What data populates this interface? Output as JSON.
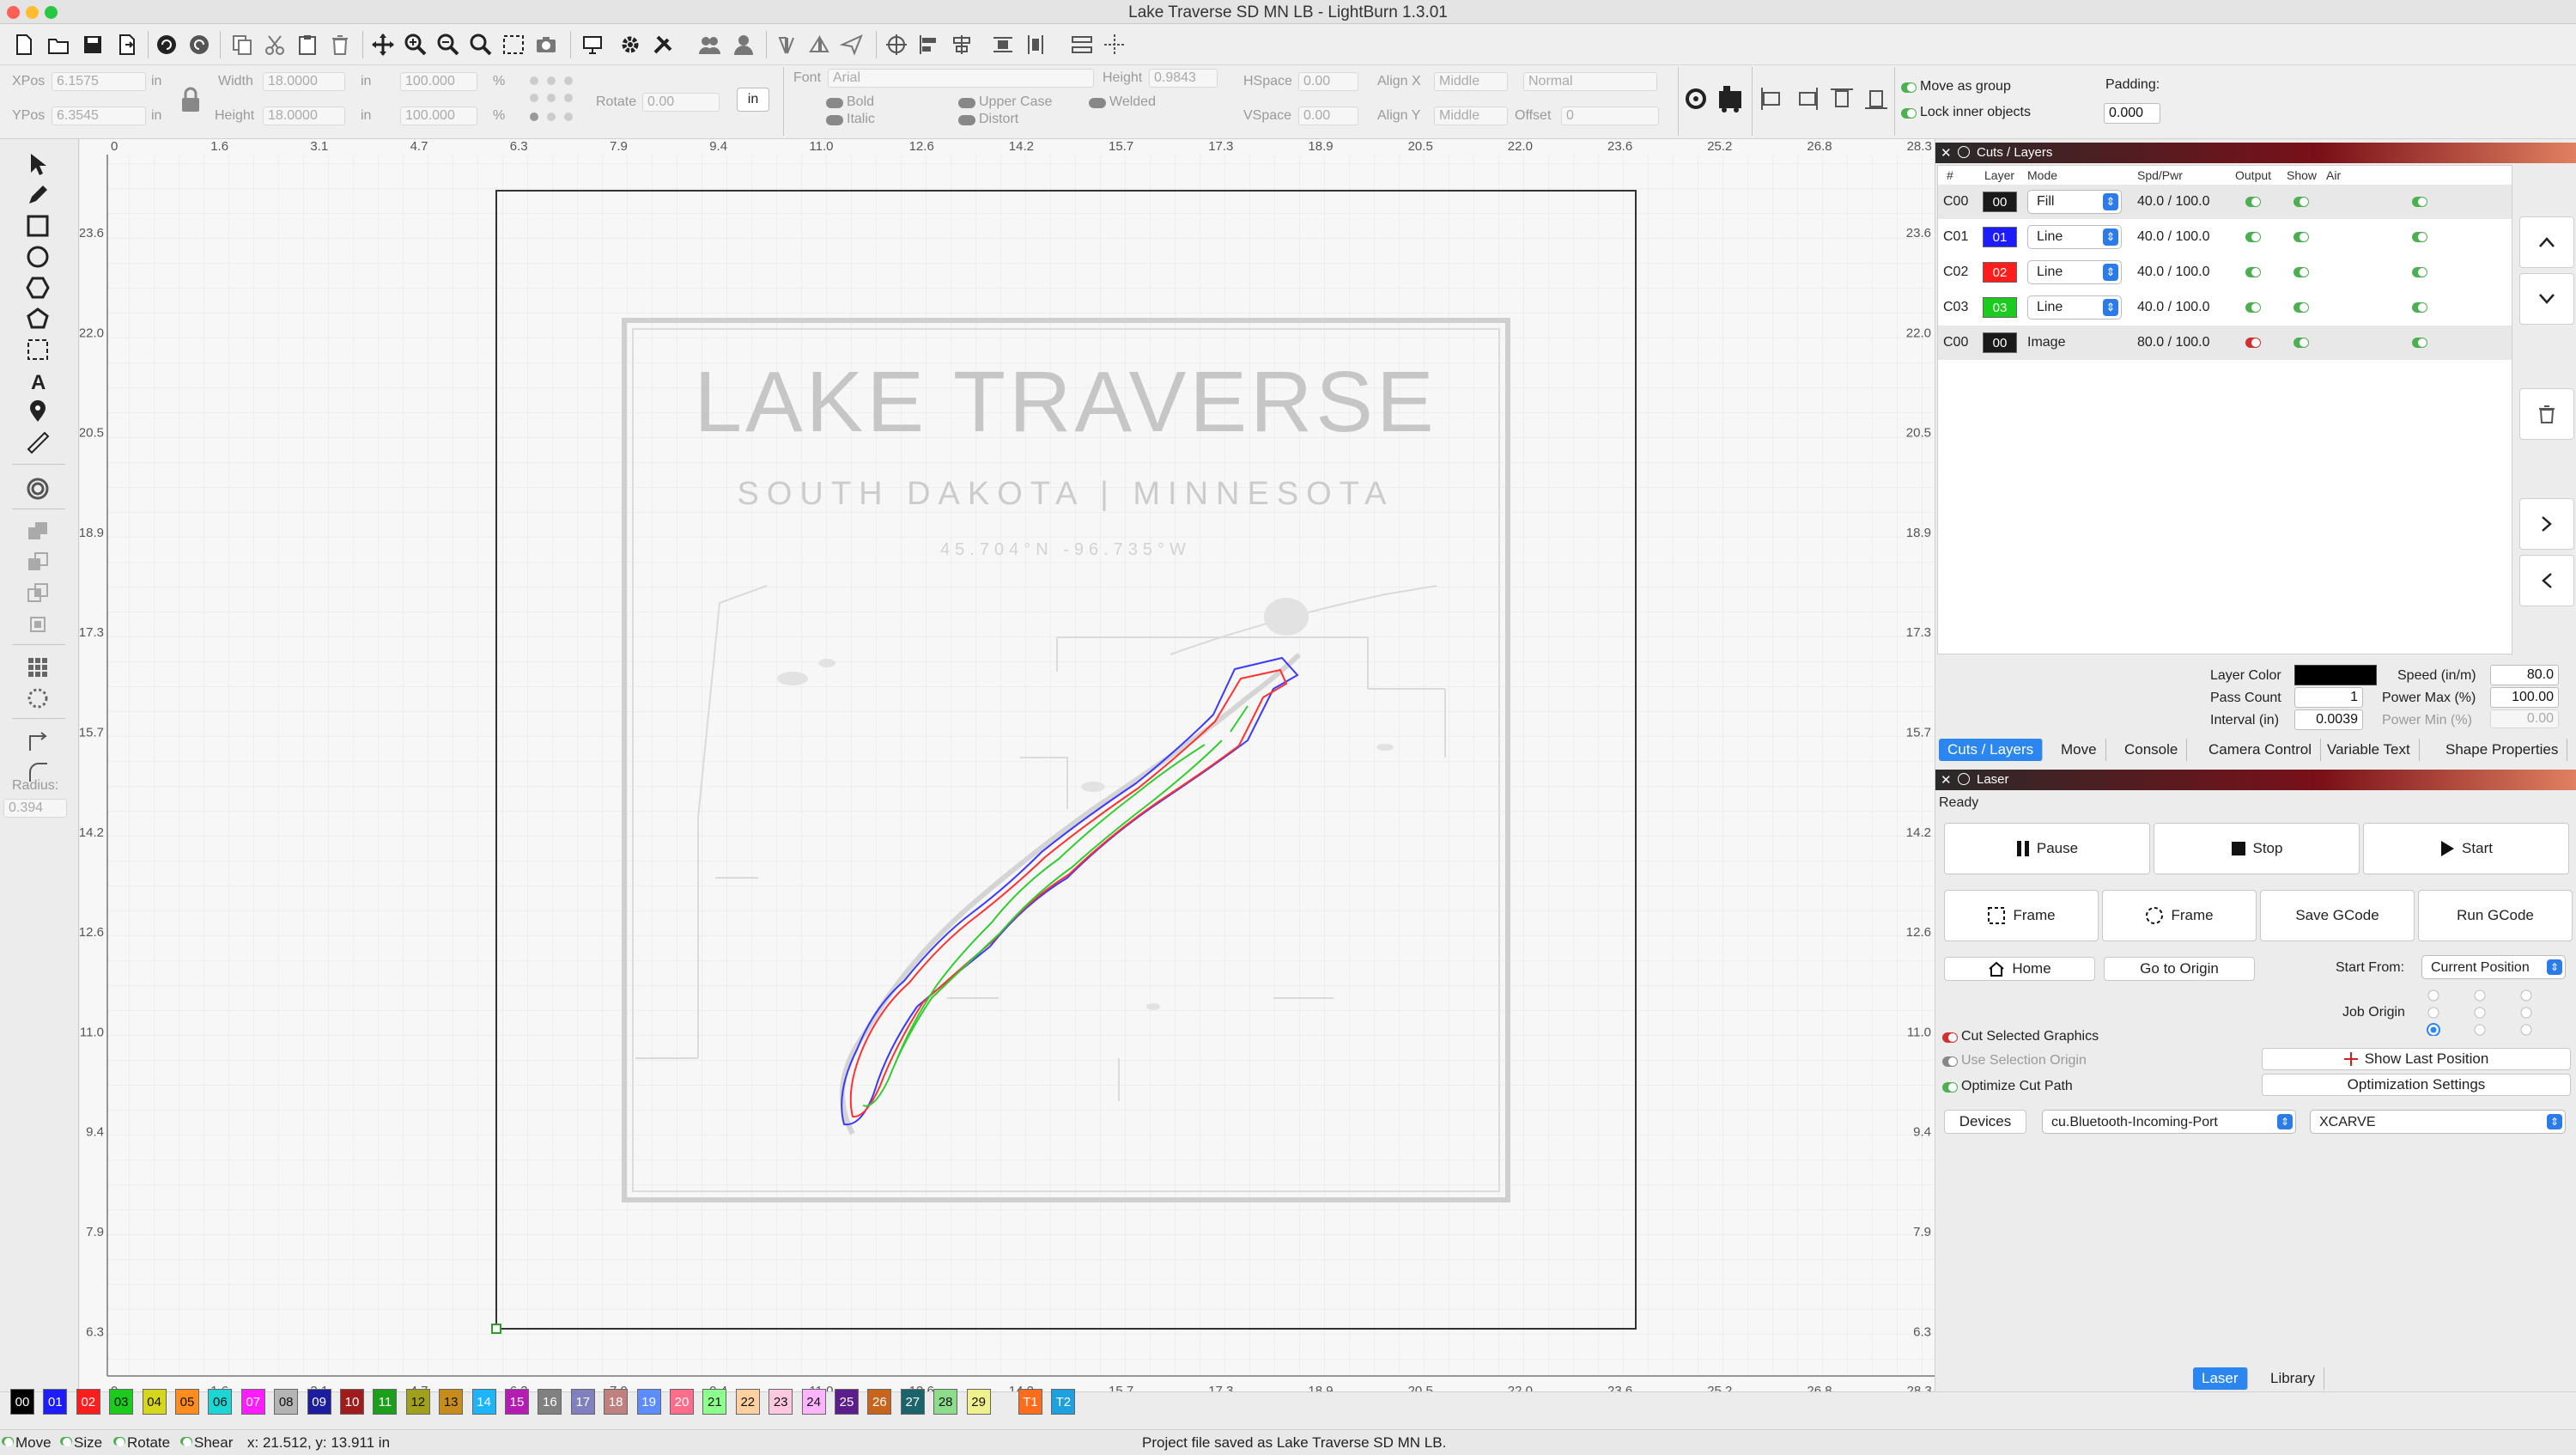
{
  "window": {
    "title": "Lake Traverse SD MN LB - LightBurn 1.3.01"
  },
  "props": {
    "xpos_label": "XPos",
    "xpos_value": "6.1575",
    "ypos_label": "YPos",
    "ypos_value": "6.3545",
    "unit": "in",
    "width_label": "Width",
    "width_value": "18.0000",
    "height_label": "Height",
    "height_value": "18.0000",
    "pct_w": "100.000",
    "pct_h": "100.000",
    "pct": "%",
    "rotate_label": "Rotate",
    "rotate_value": "0.00",
    "units_button": "in",
    "font_label": "Font",
    "font_value": "Arial",
    "fheight_label": "Height",
    "fheight_value": "0.9843",
    "hspace_label": "HSpace",
    "hspace_value": "0.00",
    "vspace_label": "VSpace",
    "vspace_value": "0.00",
    "alignx_label": "Align X",
    "alignx_value": "Middle",
    "aligny_label": "Align Y",
    "aligny_value": "Middle",
    "style_value": "Normal",
    "offset_label": "Offset",
    "offset_value": "0",
    "bold": "Bold",
    "italic": "Italic",
    "upper": "Upper Case",
    "distort": "Distort",
    "welded": "Welded",
    "move_group": "Move as group",
    "lock_inner": "Lock inner objects",
    "padding_label": "Padding:",
    "padding_value": "0.000"
  },
  "tools": {
    "radius_label": "Radius:",
    "radius_value": "0.394"
  },
  "ruler": {
    "x_ticks": [
      "0",
      "1.6",
      "3.1",
      "4.7",
      "6.3",
      "7.9",
      "9.4",
      "11.0",
      "12.6",
      "14.2",
      "15.7",
      "17.3",
      "18.9",
      "20.5",
      "22.0",
      "23.6",
      "25.2",
      "26.8",
      "28.3"
    ],
    "y_ticks": [
      "23.6",
      "22.0",
      "20.5",
      "18.9",
      "17.3",
      "15.7",
      "14.2",
      "12.6",
      "11.0",
      "9.4",
      "7.9",
      "6.3"
    ]
  },
  "artwork": {
    "title": "LAKE TRAVERSE",
    "subtitle": "SOUTH DAKOTA | MINNESOTA",
    "coords": "45.704°N    -96.735°W"
  },
  "layers": {
    "panel_title": "Cuts / Layers",
    "headers": {
      "num": "#",
      "layer": "Layer",
      "mode": "Mode",
      "spd": "Spd/Pwr",
      "output": "Output",
      "show": "Show",
      "air": "Air"
    },
    "rows": [
      {
        "num": "C00",
        "layer": "00",
        "mode": "Fill",
        "spd": "40.0 / 100.0",
        "color": "#1a1a1a"
      },
      {
        "num": "C01",
        "layer": "01",
        "mode": "Line",
        "spd": "40.0 / 100.0",
        "color": "#1c1cff"
      },
      {
        "num": "C02",
        "layer": "02",
        "mode": "Line",
        "spd": "40.0 / 100.0",
        "color": "#ff1c1c"
      },
      {
        "num": "C03",
        "layer": "03",
        "mode": "Line",
        "spd": "40.0 / 100.0",
        "color": "#1ccc1c"
      },
      {
        "num": "C00",
        "layer": "00",
        "mode": "Image",
        "spd": "80.0 / 100.0",
        "color": "#1a1a1a"
      }
    ],
    "layer_color_label": "Layer Color",
    "speed_label": "Speed (in/m)",
    "speed_value": "80.0",
    "pass_label": "Pass Count",
    "pass_value": "1",
    "power_max_label": "Power Max (%)",
    "power_max_value": "100.00",
    "interval_label": "Interval (in)",
    "interval_value": "0.0039",
    "power_min_label": "Power Min (%)",
    "power_min_value": "0.00"
  },
  "tabs": [
    "Cuts / Layers",
    "Move",
    "Console",
    "Camera Control",
    "Variable Text",
    "Shape Properties"
  ],
  "laser": {
    "panel_title": "Laser",
    "status": "Ready",
    "pause": "Pause",
    "stop": "Stop",
    "start": "Start",
    "frame1": "Frame",
    "frame2": "Frame",
    "save_gcode": "Save GCode",
    "run_gcode": "Run GCode",
    "home": "Home",
    "go_origin": "Go to Origin",
    "start_from_label": "Start From:",
    "start_from_value": "Current Position",
    "job_origin_label": "Job Origin",
    "cut_selected": "Cut Selected Graphics",
    "use_selection": "Use Selection Origin",
    "optimize": "Optimize Cut Path",
    "show_last": "Show Last Position",
    "opt_settings": "Optimization Settings",
    "devices": "Devices",
    "port": "cu.Bluetooth-Incoming-Port",
    "machine": "XCARVE"
  },
  "bottom_tabs": [
    "Laser",
    "Library"
  ],
  "palette": [
    {
      "l": "00",
      "c": "#000000"
    },
    {
      "l": "01",
      "c": "#1c1cff"
    },
    {
      "l": "02",
      "c": "#ff1c1c"
    },
    {
      "l": "03",
      "c": "#1ccc1c"
    },
    {
      "l": "04",
      "c": "#d6d61c"
    },
    {
      "l": "05",
      "c": "#ff8c1c"
    },
    {
      "l": "06",
      "c": "#1cd6d6"
    },
    {
      "l": "07",
      "c": "#ff1cff"
    },
    {
      "l": "08",
      "c": "#b4b4b4"
    },
    {
      "l": "09",
      "c": "#1c1ca0"
    },
    {
      "l": "10",
      "c": "#a01c1c"
    },
    {
      "l": "11",
      "c": "#1ca01c"
    },
    {
      "l": "12",
      "c": "#a0a01c"
    },
    {
      "l": "13",
      "c": "#c88c1c"
    },
    {
      "l": "14",
      "c": "#1cb4ff"
    },
    {
      "l": "15",
      "c": "#b41cb4"
    },
    {
      "l": "16",
      "c": "#808080"
    },
    {
      "l": "17",
      "c": "#8080c0"
    },
    {
      "l": "18",
      "c": "#c08080"
    },
    {
      "l": "19",
      "c": "#5c8cff"
    },
    {
      "l": "20",
      "c": "#ff6c8c"
    },
    {
      "l": "21",
      "c": "#8cff8c"
    },
    {
      "l": "22",
      "c": "#ffd0a0"
    },
    {
      "l": "23",
      "c": "#ffc8e0"
    },
    {
      "l": "24",
      "c": "#ffb4ff"
    },
    {
      "l": "25",
      "c": "#5c1c8c"
    },
    {
      "l": "26",
      "c": "#c8641c"
    },
    {
      "l": "27",
      "c": "#1c646c"
    },
    {
      "l": "28",
      "c": "#8cdc8c"
    },
    {
      "l": "29",
      "c": "#f0f08c"
    },
    {
      "l": "T1",
      "c": "#ff6c1c"
    },
    {
      "l": "T2",
      "c": "#1ca0e0"
    }
  ],
  "status": {
    "move": "Move",
    "size": "Size",
    "rotate": "Rotate",
    "shear": "Shear",
    "coords": "x: 21.512, y: 13.911 in",
    "message": "Project file saved as Lake Traverse SD MN LB."
  }
}
